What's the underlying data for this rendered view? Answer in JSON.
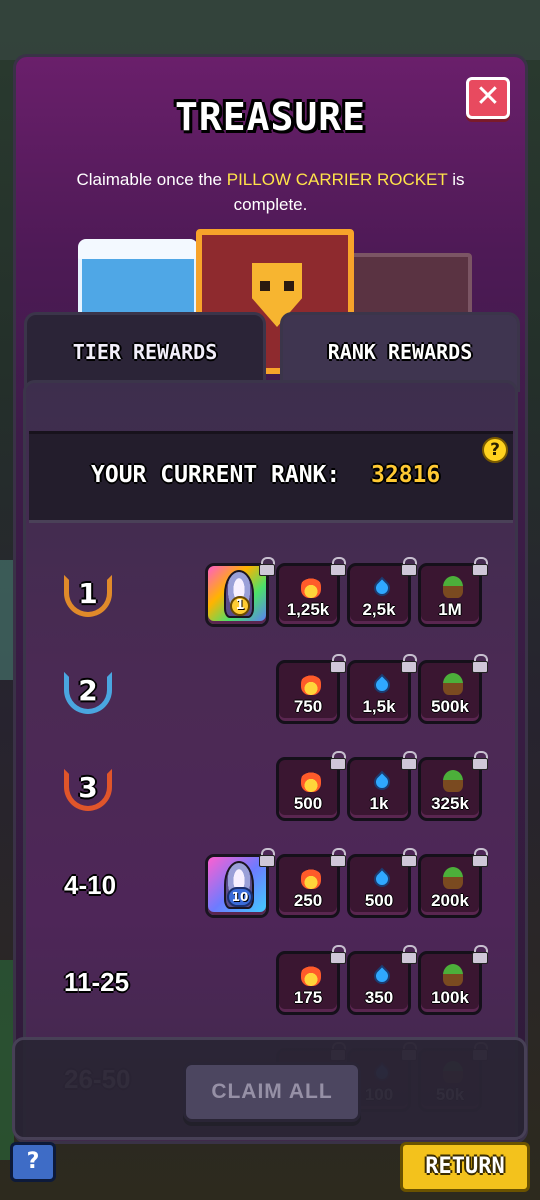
{
  "header": {
    "title": "TREASURE",
    "subtitle_prefix": "Claimable once the",
    "subtitle_highlight": "PILLOW CARRIER ROCKET",
    "subtitle_suffix": "is complete.",
    "close_label": "✕"
  },
  "tabs": [
    {
      "label": "TIER REWARDS",
      "active": false
    },
    {
      "label": "RANK REWARDS",
      "active": true
    }
  ],
  "current_rank": {
    "label": "YOUR CURRENT RANK:",
    "value": "32816",
    "help": "?"
  },
  "colors": {
    "accent": "#ffc933",
    "highlight": "#ffe34a",
    "close": "#e84a5f",
    "return": "#f3c21c"
  },
  "rows": [
    {
      "rank": "1",
      "badge_color": "#e08a2a",
      "special": {
        "badge": "1",
        "style": "rainbow"
      },
      "rewards": [
        {
          "icon": "fire-icon",
          "amount": "1,25k"
        },
        {
          "icon": "drop-icon",
          "amount": "2,5k"
        },
        {
          "icon": "sprout-icon",
          "amount": "1M"
        }
      ]
    },
    {
      "rank": "2",
      "badge_color": "#4aa6e0",
      "special": null,
      "rewards": [
        {
          "icon": "fire-icon",
          "amount": "750"
        },
        {
          "icon": "drop-icon",
          "amount": "1,5k"
        },
        {
          "icon": "sprout-icon",
          "amount": "500k"
        }
      ]
    },
    {
      "rank": "3",
      "badge_color": "#e0552a",
      "special": null,
      "rewards": [
        {
          "icon": "fire-icon",
          "amount": "500"
        },
        {
          "icon": "drop-icon",
          "amount": "1k"
        },
        {
          "icon": "sprout-icon",
          "amount": "325k"
        }
      ]
    },
    {
      "rank": "4-10",
      "badge_color": null,
      "special": {
        "badge": "10",
        "style": "blue"
      },
      "rewards": [
        {
          "icon": "fire-icon",
          "amount": "250"
        },
        {
          "icon": "drop-icon",
          "amount": "500"
        },
        {
          "icon": "sprout-icon",
          "amount": "200k"
        }
      ]
    },
    {
      "rank": "11-25",
      "badge_color": null,
      "special": null,
      "rewards": [
        {
          "icon": "fire-icon",
          "amount": "175"
        },
        {
          "icon": "drop-icon",
          "amount": "350"
        },
        {
          "icon": "sprout-icon",
          "amount": "100k"
        }
      ]
    },
    {
      "rank": "26-50",
      "badge_color": null,
      "special": null,
      "rewards": [
        {
          "icon": "fire-icon",
          "amount": ""
        },
        {
          "icon": "drop-icon",
          "amount": "100"
        },
        {
          "icon": "sprout-icon",
          "amount": "50k"
        }
      ]
    }
  ],
  "footer": {
    "claim_all": "CLAIM ALL",
    "return": "RETURN",
    "help": "?"
  }
}
